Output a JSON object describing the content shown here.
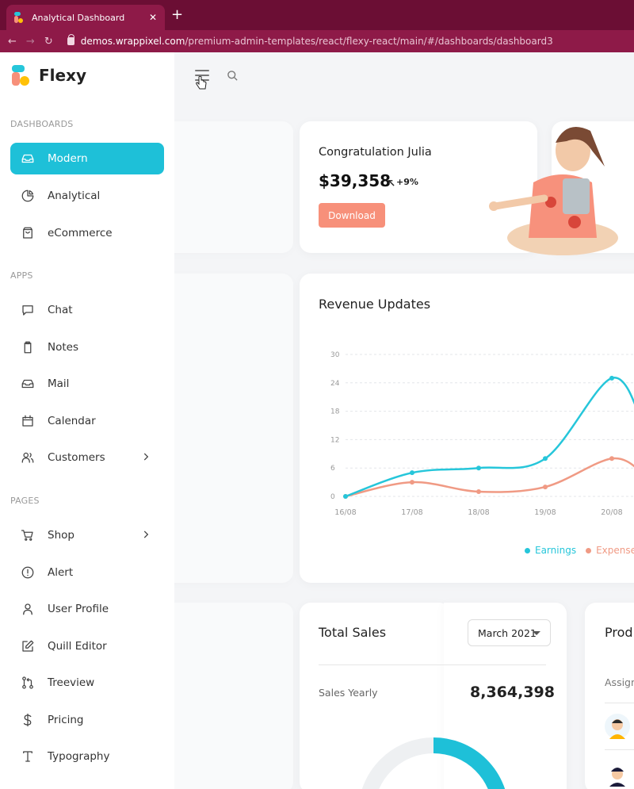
{
  "browser": {
    "tab_title": "Analytical Dashboard",
    "tab_close": "✕",
    "new_tab": "+",
    "url_domain": "demos.wrappixel.com",
    "url_path": "/premium-admin-templates/react/flexy-react/main/#/dashboards/dashboard3"
  },
  "app": {
    "name": "Flexy",
    "brand_color": "#1ec0d8",
    "accent_color": "#f7907a"
  },
  "sidebar": {
    "sections": [
      {
        "title": "DASHBOARDS",
        "items": [
          {
            "label": "Modern",
            "icon": "inbox-icon",
            "active": true
          },
          {
            "label": "Analytical",
            "icon": "pie-chart-icon"
          },
          {
            "label": "eCommerce",
            "icon": "shopping-bag-icon"
          }
        ]
      },
      {
        "title": "APPS",
        "items": [
          {
            "label": "Chat",
            "icon": "message-square-icon"
          },
          {
            "label": "Notes",
            "icon": "clipboard-icon"
          },
          {
            "label": "Mail",
            "icon": "mail-inbox-icon"
          },
          {
            "label": "Calendar",
            "icon": "calendar-icon"
          },
          {
            "label": "Customers",
            "icon": "users-icon",
            "has_children": true
          }
        ]
      },
      {
        "title": "PAGES",
        "items": [
          {
            "label": "Shop",
            "icon": "shopping-cart-icon",
            "has_children": true
          },
          {
            "label": "Alert",
            "icon": "alert-circle-icon"
          },
          {
            "label": "User Profile",
            "icon": "user-icon"
          },
          {
            "label": "Quill Editor",
            "icon": "edit-icon"
          },
          {
            "label": "Treeview",
            "icon": "git-pull-request-icon"
          },
          {
            "label": "Pricing",
            "icon": "dollar-sign-icon"
          },
          {
            "label": "Typography",
            "icon": "type-icon"
          }
        ]
      }
    ]
  },
  "congrats": {
    "title": "Congratulation Julia",
    "amount": "$39,358",
    "change": "+9%",
    "button": "Download"
  },
  "revenue": {
    "title": "Revenue Updates",
    "legend": [
      {
        "name": "Earnings",
        "color": "#26c6da"
      },
      {
        "name": "Expense",
        "color": "#f09a84"
      }
    ]
  },
  "chart_data": {
    "type": "line",
    "title": "Revenue Updates",
    "x": [
      "16/08",
      "17/08",
      "18/08",
      "19/08",
      "20/08"
    ],
    "yticks": [
      0,
      6,
      12,
      18,
      24,
      30
    ],
    "ylim": [
      0,
      30
    ],
    "grid": true,
    "legend_position": "bottom-right",
    "series": [
      {
        "name": "Earnings",
        "color": "#26c6da",
        "values": [
          0,
          5,
          6,
          8,
          25
        ]
      },
      {
        "name": "Expense",
        "color": "#f09a84",
        "values": [
          0,
          3,
          1,
          2,
          8
        ]
      }
    ]
  },
  "total_sales": {
    "title": "Total Sales",
    "select_value": "March 2021",
    "subtitle": "Sales Yearly",
    "value": "8,364,398"
  },
  "products": {
    "title": "Prod",
    "column": "Assign"
  }
}
